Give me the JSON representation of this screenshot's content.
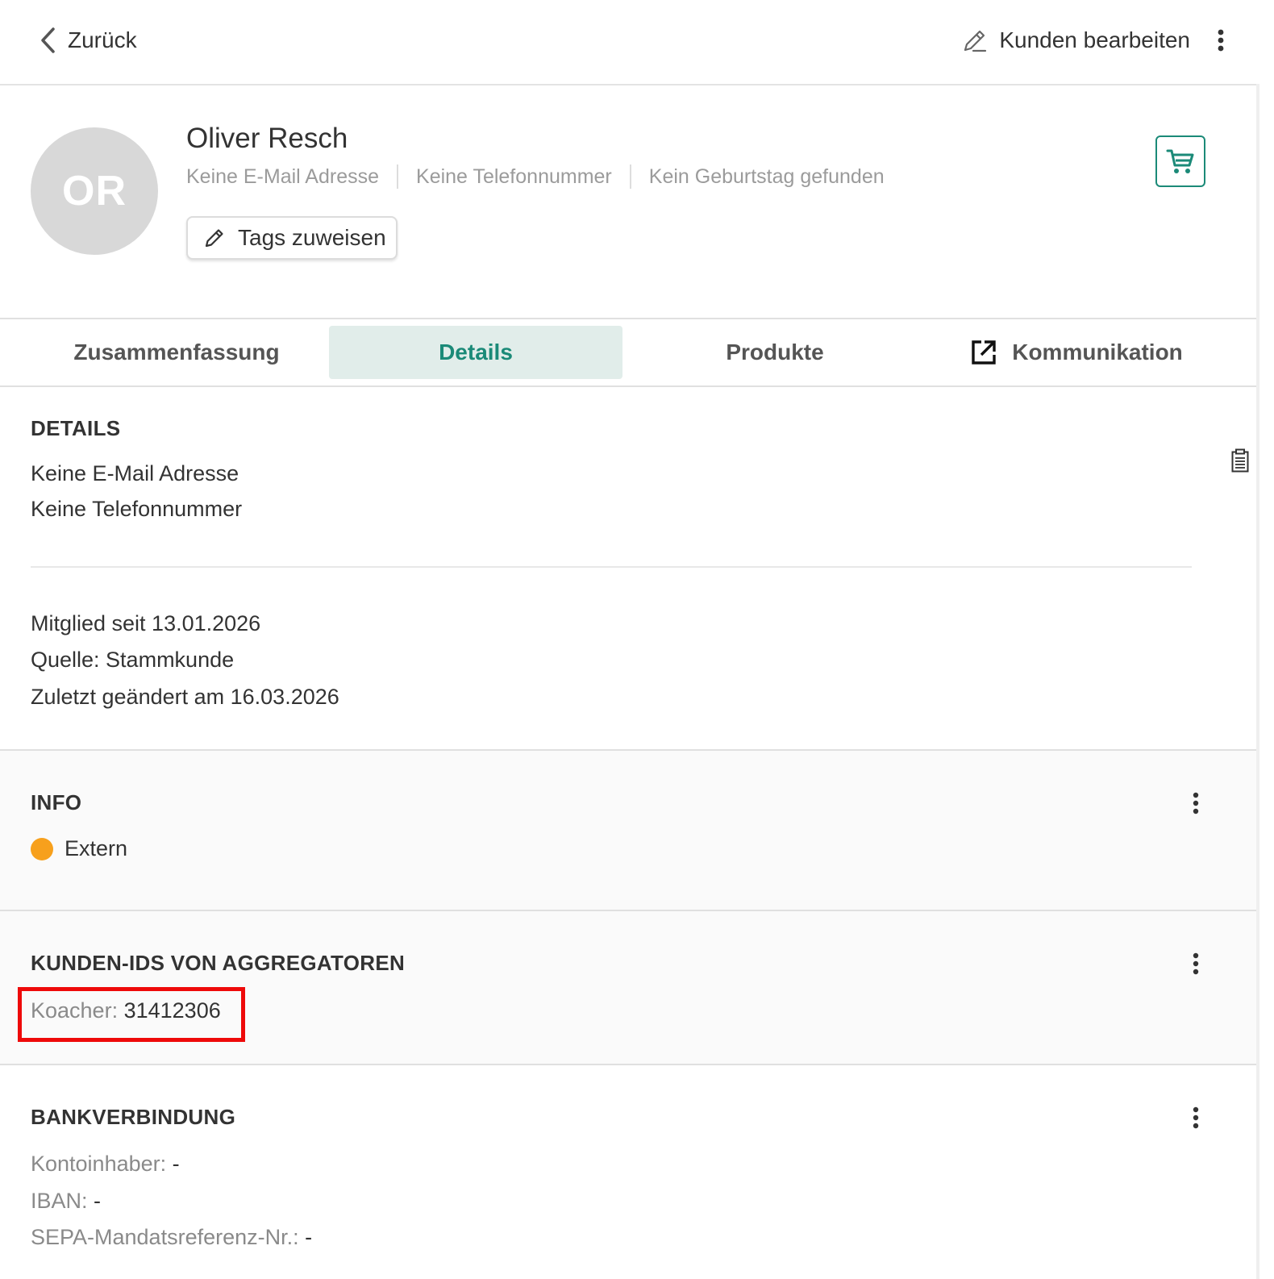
{
  "topbar": {
    "back_label": "Zurück",
    "edit_label": "Kunden bearbeiten"
  },
  "profile": {
    "initials": "OR",
    "name": "Oliver Resch",
    "email": "Keine E-Mail Adresse",
    "phone": "Keine Telefonnummer",
    "birthday": "Kein Geburtstag gefunden",
    "tags_button_label": "Tags zuweisen"
  },
  "tabs": [
    {
      "label": "Zusammenfassung",
      "active": false
    },
    {
      "label": "Details",
      "active": true
    },
    {
      "label": "Produkte",
      "active": false
    },
    {
      "label": "Kommunikation",
      "active": false
    }
  ],
  "details": {
    "title": "DETAILS",
    "email": "Keine E-Mail Adresse",
    "phone": "Keine Telefonnummer",
    "member_since": "Mitglied seit 13.01.2026",
    "source": "Quelle: Stammkunde",
    "last_changed": "Zuletzt geändert am 16.03.2026"
  },
  "info": {
    "title": "INFO",
    "status_label": "Extern",
    "status_color": "#f7a01c"
  },
  "aggregators": {
    "title": "KUNDEN-IDS VON AGGREGATOREN",
    "entry_label": "Koacher:",
    "entry_value": "31412306"
  },
  "bank": {
    "title": "BANKVERBINDUNG",
    "holder_label": "Kontoinhaber:",
    "holder_value": "-",
    "iban_label": "IBAN:",
    "iban_value": "-",
    "sepa_label": "SEPA-Mandatsreferenz-Nr.:",
    "sepa_value": "-"
  },
  "colors": {
    "accent": "#1b8a78",
    "active_tab_bg": "#e1edea",
    "highlight": "#ee0a0a"
  }
}
